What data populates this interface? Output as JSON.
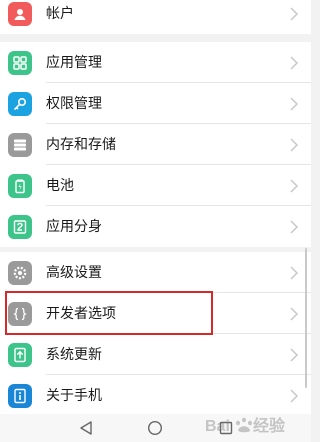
{
  "settings": {
    "items": [
      {
        "label": "帐户",
        "icon": "account-icon",
        "color": "#f25b5b"
      },
      {
        "label": "应用管理",
        "icon": "app-grid-icon",
        "color": "#3cc48a"
      },
      {
        "label": "权限管理",
        "icon": "key-icon",
        "color": "#1aa3e0"
      },
      {
        "label": "内存和存储",
        "icon": "storage-icon",
        "color": "#9a9a9a"
      },
      {
        "label": "电池",
        "icon": "battery-icon",
        "color": "#3cc48a"
      },
      {
        "label": "应用分身",
        "icon": "app-clone-icon",
        "color": "#3cc48a"
      },
      {
        "label": "高级设置",
        "icon": "gear-icon",
        "color": "#9a9a9a"
      },
      {
        "label": "开发者选项",
        "icon": "braces-icon",
        "color": "#9a9a9a"
      },
      {
        "label": "系统更新",
        "icon": "update-icon",
        "color": "#3cc48a"
      },
      {
        "label": "关于手机",
        "icon": "info-icon",
        "color": "#1a86d6"
      }
    ]
  },
  "watermark": {
    "text": "Baidu 经验"
  },
  "highlight_color": "#d62a2a"
}
